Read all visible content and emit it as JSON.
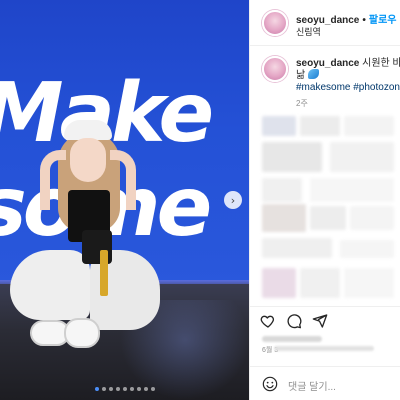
{
  "post_image": {
    "wall_text_line1": "Make",
    "wall_text_line2": "some",
    "carousel_next_glyph": "›",
    "carousel_dots": 9,
    "carousel_active_index": 0,
    "colors": {
      "wall": "#2451d6",
      "active_dot": "#4b8ef7"
    }
  },
  "header": {
    "username": "seoyu_dance",
    "separator": "•",
    "follow_label": "팔로우",
    "location": "신림역"
  },
  "caption": {
    "username": "seoyu_dance",
    "text_line1": "시원한 바다",
    "text_line2": "낢",
    "hashtags": "#makesome #photozone",
    "time_ago": "2주"
  },
  "actions": {
    "like_icon": "heart-icon",
    "comment_icon": "comment-icon",
    "share_icon": "send-icon"
  },
  "meta": {
    "date_fragment": "6월 3"
  },
  "comment_bar": {
    "emoji_icon": "smiley-icon",
    "placeholder": "댓글 달기..."
  },
  "colors": {
    "link": "#0095f6",
    "hashtag": "#00376b",
    "muted": "#8e8e8e"
  }
}
